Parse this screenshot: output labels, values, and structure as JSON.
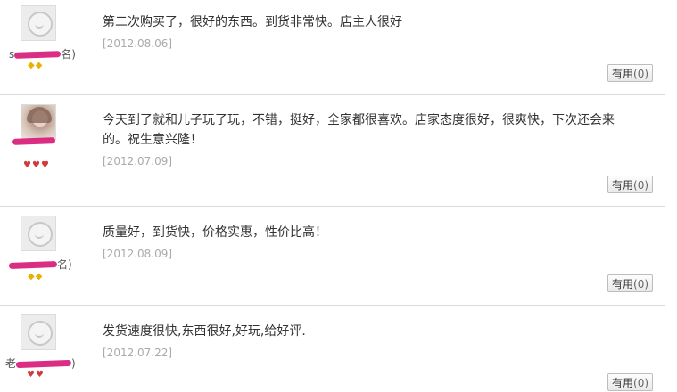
{
  "reviews": [
    {
      "username_prefix": "s",
      "username_suffix": "名)",
      "content": "第二次购买了，很好的东西。到货非常快。店主人很好",
      "date": "[2012.08.06]",
      "useful_label": "有用",
      "useful_count": "(0)",
      "badge_type": "diamond",
      "badge_count": 2
    },
    {
      "username_prefix": "",
      "username_suffix": "",
      "content": "今天到了就和儿子玩了玩，不错，挺好，全家都很喜欢。店家态度很好，很爽快，下次还会来的。祝生意兴隆！",
      "date": "[2012.07.09]",
      "useful_label": "有用",
      "useful_count": "(0)",
      "badge_type": "heart",
      "badge_count": 3
    },
    {
      "username_prefix": "",
      "username_suffix": "名)",
      "content": "质量好，到货快，价格实惠，性价比高！",
      "date": "[2012.08.09]",
      "useful_label": "有用",
      "useful_count": "(0)",
      "badge_type": "diamond",
      "badge_count": 2
    },
    {
      "username_prefix": "老",
      "username_suffix": ")",
      "content": "发货速度很快,东西很好,好玩,给好评.",
      "date": "[2012.07.22]",
      "useful_label": "有用",
      "useful_count": "(0)",
      "badge_type": "heart",
      "badge_count": 2
    }
  ],
  "icons": {
    "diamond": "◆",
    "heart": "♥"
  }
}
